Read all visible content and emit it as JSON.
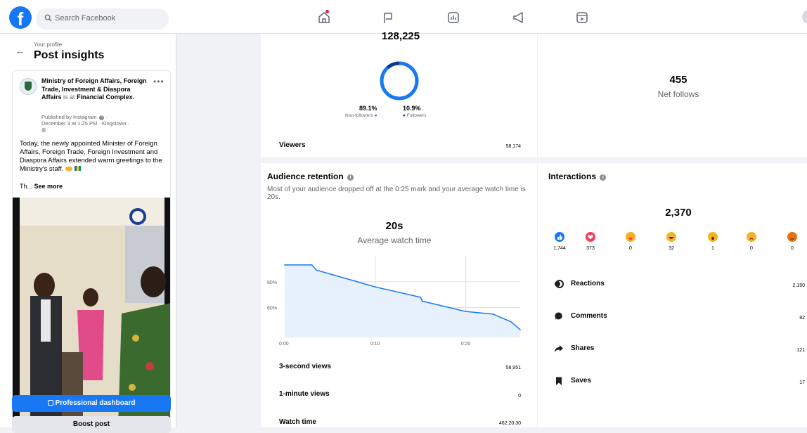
{
  "topbar": {
    "logo": "f",
    "search_placeholder": "Search Facebook",
    "nav_icons": [
      "home-icon",
      "flag-icon",
      "chart-icon",
      "megaphone-icon",
      "video-icon"
    ]
  },
  "sidebar": {
    "breadcrumb": "Your profile",
    "title": "Post insights",
    "post": {
      "page_name": "Ministry of Foreign Affairs, Foreign Trade, Investment & Diaspora Affairs",
      "is_at": "is at",
      "location": "Financial Complex",
      "published_by": "Published by Instagram",
      "date": "December 3 at 1:25 PM · Kingstown ·",
      "text": "Today, the newly appointed Minister of Foreign Affairs, Foreign Trade, Foreign Investment and Diaspora Affairs extended warm greetings to the Ministry's staff.",
      "truncated": "Th...",
      "see_more": "See more"
    },
    "professional_dashboard": "Professional dashboard",
    "boost_post": "Boost post"
  },
  "viewers_panel": {
    "total": "128,225",
    "non_followers_pct": "89.1%",
    "non_followers_label": "Non-followers",
    "followers_pct": "10.9%",
    "followers_label": "Followers",
    "viewers_label": "Viewers",
    "viewers_value": "58,174"
  },
  "follows_panel": {
    "value": "455",
    "label": "Net follows"
  },
  "retention": {
    "title": "Audience retention",
    "description": "Most of your audience dropped off at the 0:25 mark and your average watch time is 20s.",
    "avg_value": "20s",
    "avg_label": "Average watch time",
    "rows": [
      {
        "label": "3-second views",
        "value": "58,951"
      },
      {
        "label": "1-minute views",
        "value": "0"
      },
      {
        "label": "Watch time",
        "value": "462:20:30"
      }
    ]
  },
  "chart_data": {
    "type": "area",
    "x": [
      0,
      3,
      3.5,
      10,
      15,
      15.2,
      20,
      23,
      25,
      26
    ],
    "y": [
      93,
      93,
      89,
      76,
      68,
      65,
      57,
      55,
      49,
      43
    ],
    "xticks": [
      "0:00",
      "0:10",
      "0:20"
    ],
    "yticks": [
      "80%",
      "60%"
    ],
    "xlim": [
      0,
      26
    ],
    "ylim": [
      37,
      100
    ],
    "grid": true,
    "fill_color": "#e7f0fd",
    "line_color": "#1877f2"
  },
  "interactions": {
    "title": "Interactions",
    "total": "2,370",
    "reactions": [
      {
        "name": "like",
        "count": "1,744",
        "color": "#1877f2"
      },
      {
        "name": "love",
        "count": "373",
        "color": "#f33e58"
      },
      {
        "name": "care",
        "count": "0",
        "color": "#f7b125"
      },
      {
        "name": "haha",
        "count": "32",
        "color": "#f7b125"
      },
      {
        "name": "wow",
        "count": "1",
        "color": "#f7b125"
      },
      {
        "name": "sad",
        "count": "0",
        "color": "#f7b125"
      },
      {
        "name": "angry",
        "count": "0",
        "color": "#e9710f"
      }
    ],
    "rows": [
      {
        "label": "Reactions",
        "value": "2,150",
        "icon": "reactions-icon"
      },
      {
        "label": "Comments",
        "value": "82",
        "icon": "comment-icon"
      },
      {
        "label": "Shares",
        "value": "121",
        "icon": "share-icon"
      },
      {
        "label": "Saves",
        "value": "17",
        "icon": "bookmark-icon"
      }
    ]
  }
}
